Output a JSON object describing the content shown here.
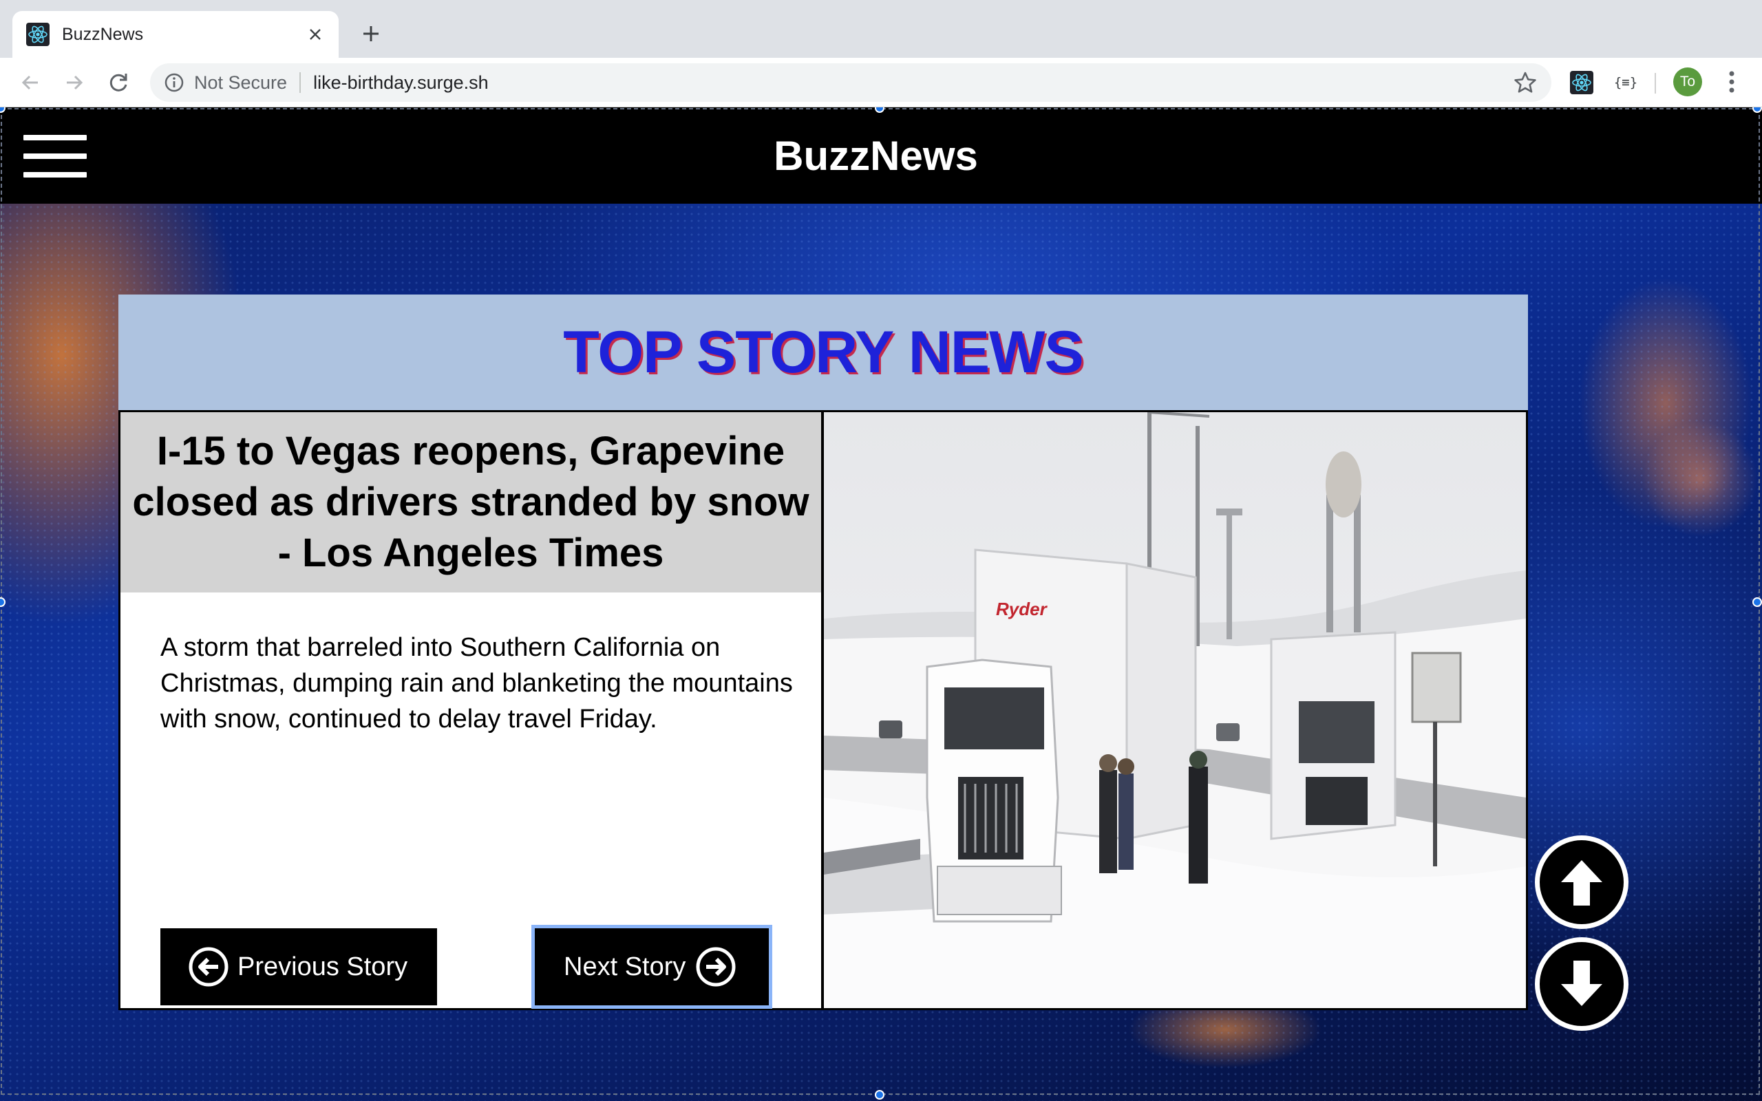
{
  "browser": {
    "tab_title": "BuzzNews",
    "security_label": "Not Secure",
    "url": "like-birthday.surge.sh",
    "profile_initials": "To",
    "extension_label": "{≡}"
  },
  "site": {
    "brand": "BuzzNews",
    "section_title": "TOP STORY NEWS",
    "story": {
      "headline": "I-15 to Vegas reopens, Grapevine closed as drivers stranded by snow - Los Angeles Times",
      "summary": "A storm that barreled into Southern California on Christmas, dumping rain and blanketing the mountains with snow, continued to delay travel Friday.",
      "image_sign_text": "Ryder"
    },
    "buttons": {
      "previous": "Previous Story",
      "next": "Next Story"
    }
  },
  "colors": {
    "header_bg": "#000000",
    "section_header_bg": "#aec3e0",
    "section_title_color": "#1e22d9",
    "section_title_shadow": "#c42a4d",
    "headline_bg": "#d3d3d3",
    "focus_ring": "#8ab4f8"
  },
  "icons": [
    "react-favicon-icon",
    "close-icon",
    "plus-icon",
    "back-arrow-icon",
    "forward-arrow-icon",
    "reload-icon",
    "info-icon",
    "star-icon",
    "react-extension-icon",
    "json-extension-icon",
    "more-vert-icon",
    "hamburger-menu-icon",
    "arrow-left-circle-icon",
    "arrow-right-circle-icon",
    "arrow-up-icon",
    "arrow-down-icon"
  ]
}
